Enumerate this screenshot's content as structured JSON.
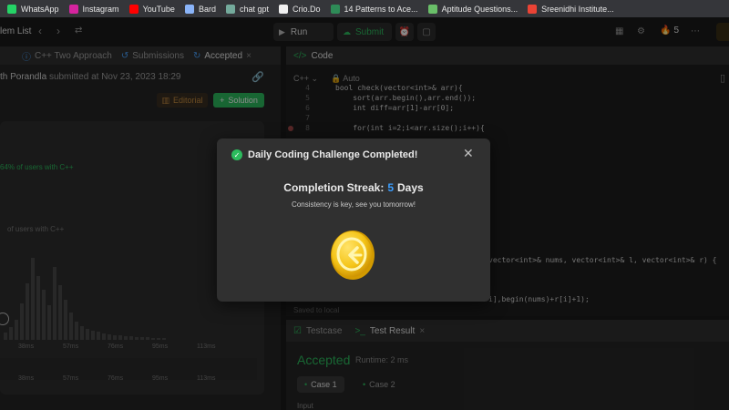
{
  "bookmarks": [
    {
      "label": "WhatsApp",
      "icon": "whatsapp-icon",
      "color": "#25d366"
    },
    {
      "label": "Instagram",
      "icon": "instagram-icon",
      "color": "#d6249f"
    },
    {
      "label": "YouTube",
      "icon": "youtube-icon",
      "color": "#ff0000"
    },
    {
      "label": "Bard",
      "icon": "bard-icon",
      "color": "#8ab4f8"
    },
    {
      "label": "chat gpt",
      "icon": "chatgpt-icon",
      "color": "#74aa9c"
    },
    {
      "label": "Crio.Do",
      "icon": "crio-icon",
      "color": "#f0f0f0"
    },
    {
      "label": "14 Patterns to Ace...",
      "icon": "patterns-icon",
      "color": "#2e8b57"
    },
    {
      "label": "Aptitude Questions...",
      "icon": "aptitude-icon",
      "color": "#6abf69"
    },
    {
      "label": "Sreenidhi Institute...",
      "icon": "gmail-icon",
      "color": "#ea4335"
    }
  ],
  "topnav": {
    "title": "lem List",
    "run_label": "Run",
    "submit_label": "Submit",
    "streak_count": "5"
  },
  "left": {
    "tabs": [
      "C++ Two Approach",
      "Submissions",
      "Accepted"
    ],
    "author_name": "th Porandla",
    "submitted_text": "submitted at Nov 23, 2023 18:29",
    "editorial_label": "Editorial",
    "solution_label": "Solution",
    "beats_runtime": "64% of users with C++",
    "beats_memory": "of users with C++",
    "axis_top": [
      "38ms",
      "57ms",
      "76ms",
      "95ms",
      "113ms"
    ],
    "axis_bot": [
      "38ms",
      "57ms",
      "76ms",
      "95ms",
      "113ms"
    ]
  },
  "editor": {
    "tab_label": "Code",
    "language": "C++",
    "mode": "Auto",
    "saved": "Saved to local",
    "lines": [
      {
        "n": "4",
        "text": "bool check(vector<int>& arr){"
      },
      {
        "n": "5",
        "text": "    sort(arr.begin(),arr.end());"
      },
      {
        "n": "6",
        "text": "    int diff=arr[1]-arr[0];"
      },
      {
        "n": "7",
        "text": ""
      },
      {
        "n": "8",
        "text": "    for(int i=2;i<arr.size();i++){"
      }
    ],
    "hidden_right_1": "vector<int>& nums, vector<int>& l, vector<int>& r) {",
    "hidden_right_2": "i],begin(nums)+r[i]+1);"
  },
  "result": {
    "tabs": [
      "Testcase",
      "Test Result"
    ],
    "status": "Accepted",
    "runtime": "Runtime: 2 ms",
    "cases": [
      "Case 1",
      "Case 2"
    ],
    "input_label": "Input"
  },
  "modal": {
    "title": "Daily Coding Challenge Completed!",
    "streak_label": "Completion Streak:",
    "streak_value": "5",
    "streak_unit": "Days",
    "subtitle": "Consistency is key, see you tomorrow!"
  },
  "colors": {
    "accent_green": "#2cbb5d",
    "accent_blue": "#3b9eff",
    "coin_gold": "#f5c518"
  }
}
